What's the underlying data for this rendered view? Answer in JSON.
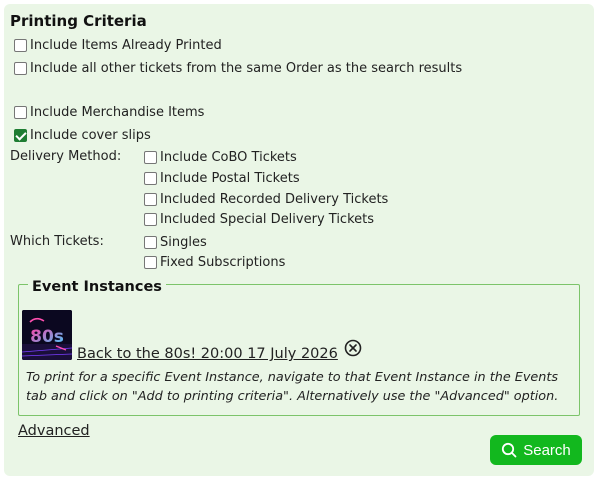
{
  "panel": {
    "title": "Printing Criteria"
  },
  "options": {
    "include_printed": {
      "label": "Include Items Already Printed",
      "checked": false
    },
    "include_same_order": {
      "label": "Include all other tickets from the same Order as the search results",
      "checked": false
    },
    "include_merch": {
      "label": "Include Merchandise Items",
      "checked": false
    },
    "include_cover": {
      "label": "Include cover slips",
      "checked": true
    }
  },
  "delivery": {
    "label": "Delivery Method:",
    "items": [
      {
        "label": "Include CoBO Tickets",
        "checked": false
      },
      {
        "label": "Include Postal Tickets",
        "checked": false
      },
      {
        "label": "Included Recorded Delivery Tickets",
        "checked": false
      },
      {
        "label": "Included Special Delivery Tickets",
        "checked": false
      }
    ]
  },
  "which": {
    "label": "Which Tickets:",
    "items": [
      {
        "label": "Singles",
        "checked": false
      },
      {
        "label": "Fixed Subscriptions",
        "checked": false
      }
    ]
  },
  "events": {
    "legend": "Event Instances",
    "instance_label": "Back to the 80s! 20:00 17 July 2026",
    "help": "To print for a specific Event Instance, navigate to that Event Instance in the Events tab and click on \"Add to printing criteria\". Alternatively use the \"Advanced\" option.",
    "thumb_text": "80s"
  },
  "advanced_link": "Advanced",
  "search_button": "Search",
  "colors": {
    "panel_bg": "#eaf6e6",
    "accent": "#12b81e",
    "fieldset_border": "#7cc46a",
    "checked": "#1e7d32"
  }
}
